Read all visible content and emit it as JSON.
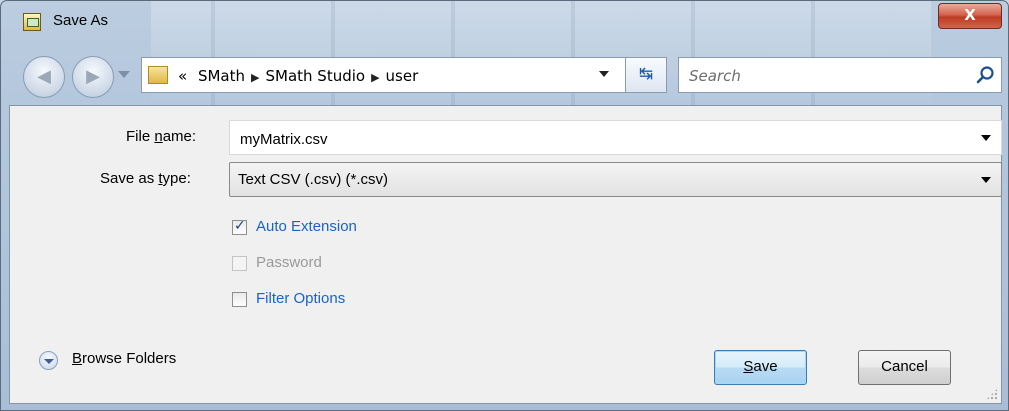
{
  "window": {
    "title": "Save As",
    "close_label": "X"
  },
  "nav": {
    "breadcrumb": [
      {
        "label": "SMath"
      },
      {
        "label": "SMath Studio"
      },
      {
        "label": "user"
      }
    ],
    "overflow": "«",
    "search_placeholder": "Search"
  },
  "form": {
    "filename_label_pre": "File ",
    "filename_label_u": "n",
    "filename_label_post": "ame:",
    "filename_value": "myMatrix.csv",
    "type_label_pre": "Save as ",
    "type_label_u": "t",
    "type_label_post": "ype:",
    "type_value": "Text CSV (.csv) (*.csv)"
  },
  "options": [
    {
      "label": "Auto Extension",
      "checked": true,
      "enabled": true
    },
    {
      "label": "Password",
      "checked": false,
      "enabled": false
    },
    {
      "label": "Filter Options",
      "checked": false,
      "enabled": true
    }
  ],
  "footer": {
    "browse_u": "B",
    "browse_rest": "rowse Folders",
    "save_u": "S",
    "save_rest": "ave",
    "cancel_label": "Cancel"
  },
  "colors": {
    "accent_link": "#1a63c6",
    "close_button": "#c9452c"
  },
  "icons": [
    "dialog-icon",
    "back-icon",
    "forward-icon",
    "folder-icon",
    "refresh-icon",
    "search-icon",
    "browse-expand-icon"
  ]
}
